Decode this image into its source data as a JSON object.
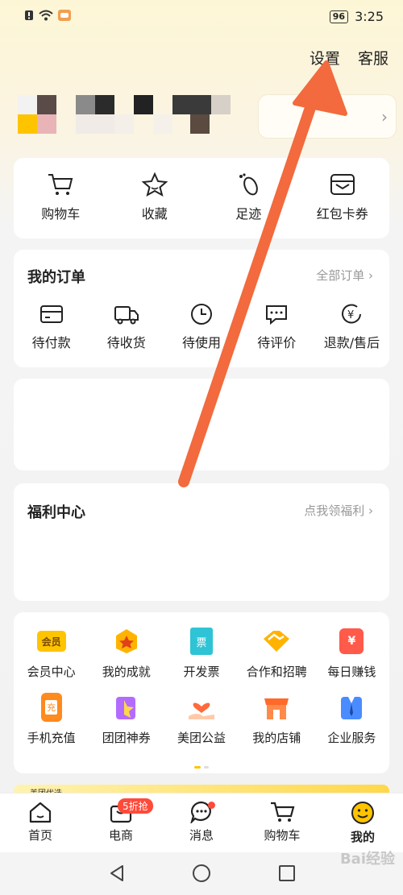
{
  "status": {
    "time": "3:25",
    "battery": "96"
  },
  "header": {
    "settings": "设置",
    "service": "客服"
  },
  "quick_links": [
    {
      "label": "购物车",
      "icon": "cart-icon"
    },
    {
      "label": "收藏",
      "icon": "star-icon"
    },
    {
      "label": "足迹",
      "icon": "footprint-icon"
    },
    {
      "label": "红包卡券",
      "icon": "wallet-icon"
    }
  ],
  "orders": {
    "title": "我的订单",
    "more": "全部订单",
    "items": [
      {
        "label": "待付款",
        "icon": "card-icon"
      },
      {
        "label": "待收货",
        "icon": "truck-icon"
      },
      {
        "label": "待使用",
        "icon": "clock-icon"
      },
      {
        "label": "待评价",
        "icon": "chat-icon"
      },
      {
        "label": "退款/售后",
        "icon": "refund-icon"
      }
    ]
  },
  "welfare": {
    "title": "福利中心",
    "more": "点我领福利"
  },
  "services": [
    {
      "label": "会员中心",
      "icon": "member-icon",
      "badge": "会员"
    },
    {
      "label": "我的成就",
      "icon": "achievement-icon"
    },
    {
      "label": "开发票",
      "icon": "invoice-icon",
      "badge": "票"
    },
    {
      "label": "合作和招聘",
      "icon": "handshake-icon"
    },
    {
      "label": "每日赚钱",
      "icon": "earn-icon",
      "badge": "¥"
    },
    {
      "label": "手机充值",
      "icon": "recharge-icon",
      "badge": "充"
    },
    {
      "label": "团团神券",
      "icon": "coupon-icon"
    },
    {
      "label": "美团公益",
      "icon": "charity-icon"
    },
    {
      "label": "我的店铺",
      "icon": "shop-icon"
    },
    {
      "label": "企业服务",
      "icon": "enterprise-icon"
    }
  ],
  "banner": {
    "text": "美团优选"
  },
  "tabs": [
    {
      "label": "首页",
      "icon": "home-icon"
    },
    {
      "label": "电商",
      "icon": "ecommerce-icon",
      "promo": "5折抢"
    },
    {
      "label": "消息",
      "icon": "message-icon"
    },
    {
      "label": "购物车",
      "icon": "cart-icon"
    },
    {
      "label": "我的",
      "icon": "mine-icon"
    }
  ],
  "watermark": "Bai经验",
  "colors": {
    "accent": "#ffc400",
    "annotation_arrow": "#f26a3d",
    "badge_red": "#ff4a3a"
  }
}
